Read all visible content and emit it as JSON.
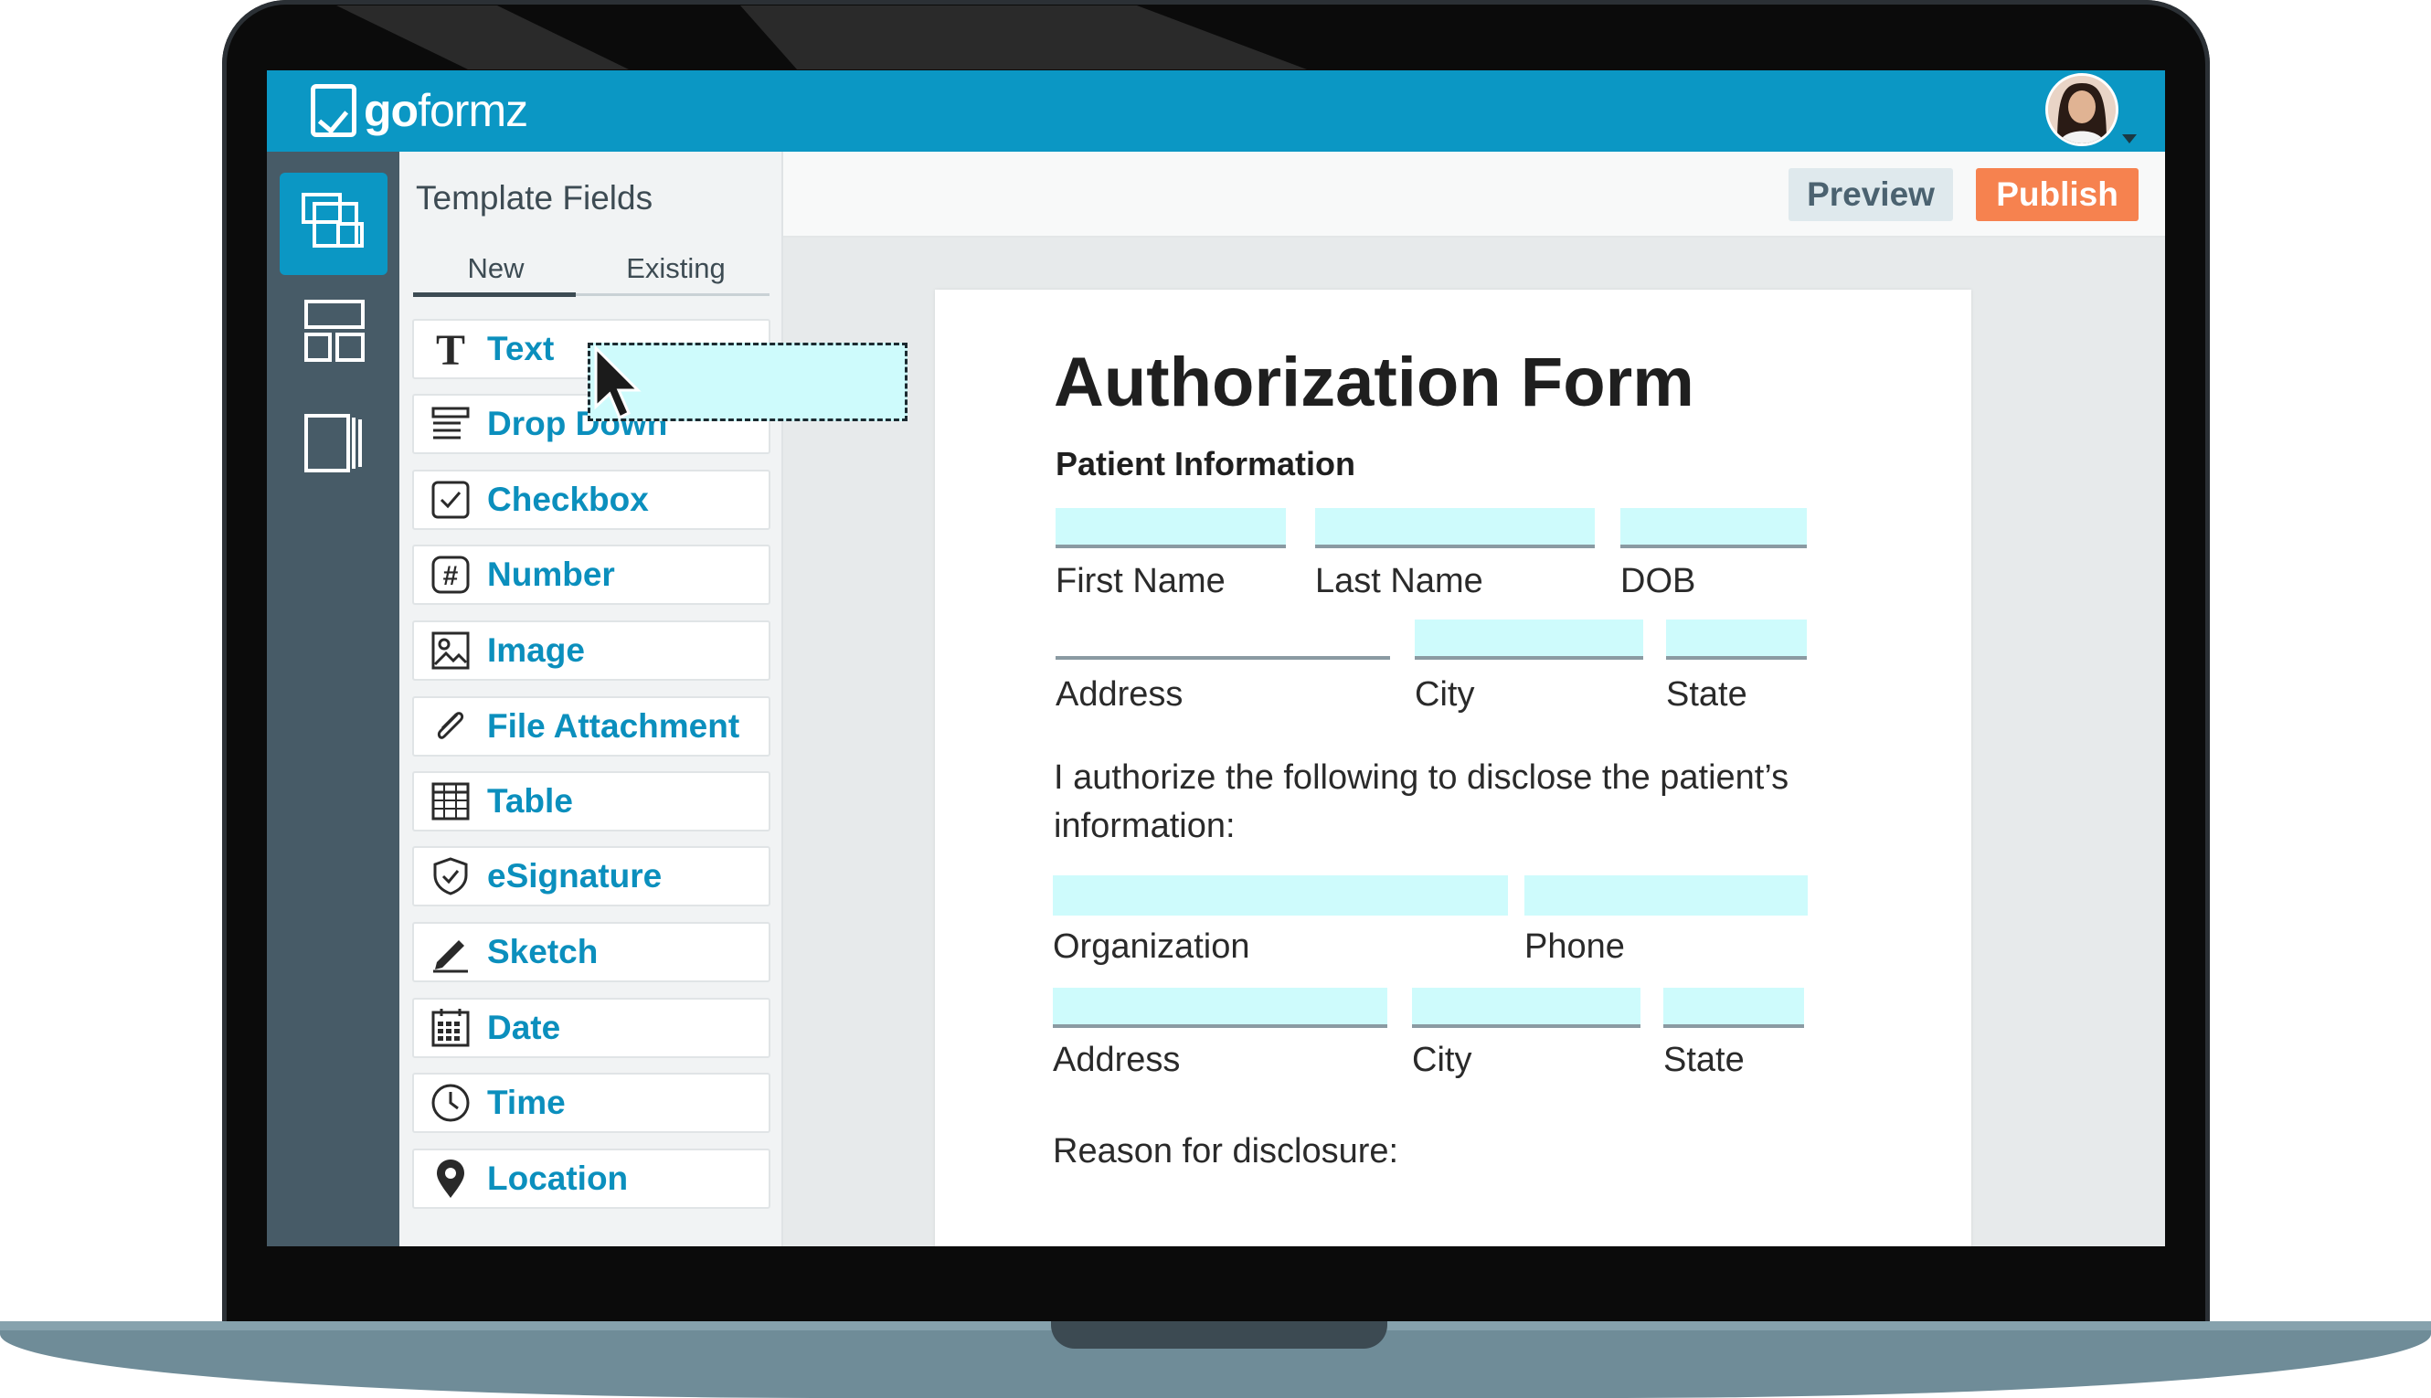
{
  "app": {
    "logo_prefix": "go",
    "logo_suffix": "formz"
  },
  "panel": {
    "title": "Template Fields",
    "tabs": [
      "New",
      "Existing"
    ],
    "fields": [
      {
        "label": "Text",
        "icon": "text-t-icon"
      },
      {
        "label": "Drop Down",
        "icon": "dropdown-list-icon"
      },
      {
        "label": "Checkbox",
        "icon": "checkbox-icon"
      },
      {
        "label": "Number",
        "icon": "hash-icon"
      },
      {
        "label": "Image",
        "icon": "image-icon"
      },
      {
        "label": "File Attachment",
        "icon": "paperclip-icon"
      },
      {
        "label": "Table",
        "icon": "table-grid-icon"
      },
      {
        "label": "eSignature",
        "icon": "shield-check-icon"
      },
      {
        "label": "Sketch",
        "icon": "pen-icon"
      },
      {
        "label": "Date",
        "icon": "calendar-icon"
      },
      {
        "label": "Time",
        "icon": "clock-icon"
      },
      {
        "label": "Location",
        "icon": "map-pin-icon"
      }
    ]
  },
  "toolbar": {
    "preview_label": "Preview",
    "publish_label": "Publish"
  },
  "form": {
    "title": "Authorization Form",
    "patient_section": "Patient Information",
    "labels": {
      "first_name": "First Name",
      "last_name": "Last Name",
      "dob": "DOB",
      "address": "Address",
      "city": "City",
      "state": "State",
      "organization": "Organization",
      "phone": "Phone",
      "address2": "Address",
      "city2": "City",
      "state2": "State"
    },
    "authorize_text": "I authorize the following to disclose the patient’s information:",
    "reason_label": "Reason for disclosure:"
  },
  "colors": {
    "brand": "#0b97c4",
    "publish": "#f6824f",
    "field_fill": "#cefbfc",
    "rail": "#475b67"
  }
}
